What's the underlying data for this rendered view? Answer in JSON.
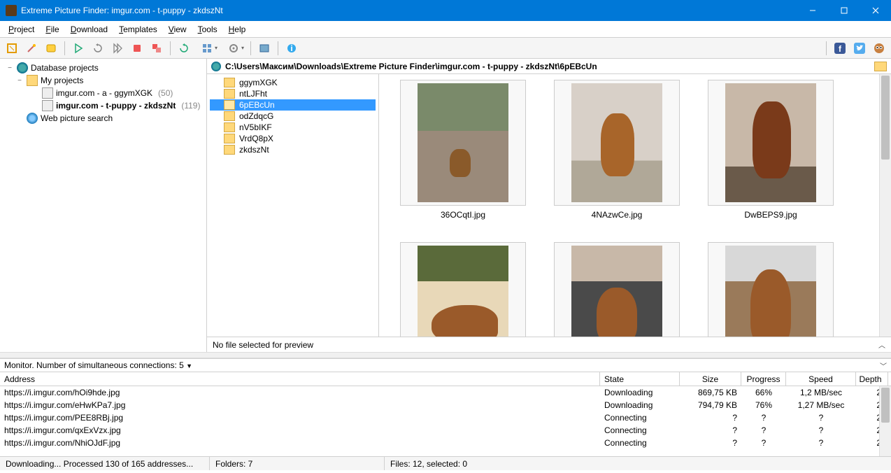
{
  "title": "Extreme Picture Finder: imgur.com - t-puppy - zkdszNt",
  "menus": [
    "Project",
    "File",
    "Download",
    "Templates",
    "View",
    "Tools",
    "Help"
  ],
  "menu_mnemonic_index": [
    0,
    0,
    0,
    0,
    0,
    0,
    0
  ],
  "tree": {
    "root": "Database projects",
    "myprojects": "My projects",
    "items": [
      {
        "label": "imgur.com - a - ggymXGK",
        "count": "(50)",
        "selected": false
      },
      {
        "label": "imgur.com - t-puppy - zkdszNt",
        "count": "(119)",
        "selected": true
      }
    ],
    "websearch": "Web picture search"
  },
  "path": "C:\\Users\\Максим\\Downloads\\Extreme Picture Finder\\imgur.com - t-puppy - zkdszNt\\6pEBcUn",
  "folders": [
    "ggymXGK",
    "ntLJFht",
    "6pEBcUn",
    "odZdqcG",
    "nV5bIKF",
    "VrdQ8pX",
    "zkdszNt"
  ],
  "folder_selected_index": 2,
  "thumbs": [
    "36OCqtI.jpg",
    "4NAzwCe.jpg",
    "DwBEPS9.jpg",
    "",
    "",
    ""
  ],
  "preview_text": "No file selected for preview",
  "monitor_label": "Monitor. Number of simultaneous connections: 5",
  "columns": {
    "address": "Address",
    "state": "State",
    "size": "Size",
    "progress": "Progress",
    "speed": "Speed",
    "depth": "Depth"
  },
  "rows": [
    {
      "address": "https://i.imgur.com/hOi9hde.jpg",
      "state": "Downloading",
      "size": "869,75 KB",
      "progress": "66%",
      "speed": "1,2 MB/sec",
      "depth": "2"
    },
    {
      "address": "https://i.imgur.com/eHwKPa7.jpg",
      "state": "Downloading",
      "size": "794,79 KB",
      "progress": "76%",
      "speed": "1,27 MB/sec",
      "depth": "2"
    },
    {
      "address": "https://i.imgur.com/PEE8RBj.jpg",
      "state": "Connecting",
      "size": "?",
      "progress": "?",
      "speed": "?",
      "depth": "2"
    },
    {
      "address": "https://i.imgur.com/qxExVzx.jpg",
      "state": "Connecting",
      "size": "?",
      "progress": "?",
      "speed": "?",
      "depth": "2"
    },
    {
      "address": "https://i.imgur.com/NhiOJdF.jpg",
      "state": "Connecting",
      "size": "?",
      "progress": "?",
      "speed": "?",
      "depth": "2"
    }
  ],
  "status": {
    "s1": "Downloading... Processed 130 of 165 addresses...",
    "s2": "Folders: 7",
    "s3": "Files: 12, selected: 0"
  }
}
